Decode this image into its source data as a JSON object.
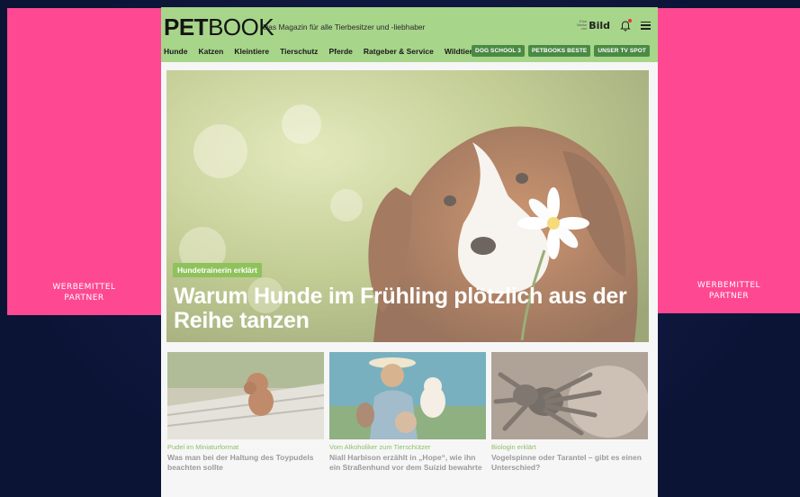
{
  "ads": {
    "left": {
      "line1": "WERBEMITTEL",
      "line2": "PARTNER"
    },
    "right": {
      "line1": "WERBEMITTEL",
      "line2": "PARTNER"
    }
  },
  "header": {
    "logo_bold": "PET",
    "logo_light": "BOOK",
    "tagline": "Das Magazin für alle Tierbesitzer und -liebhaber",
    "bild_small": "Eine Marke von",
    "bild_word": "Bild"
  },
  "nav": {
    "items": [
      "Hunde",
      "Katzen",
      "Kleintiere",
      "Tierschutz",
      "Pferde",
      "Ratgeber & Service",
      "Wildtiere"
    ],
    "buttons": [
      "DOG SCHOOL 3",
      "PETBOOKS BESTE",
      "UNSER TV SPOT"
    ]
  },
  "hero": {
    "tag": "Hundetrainerin erklärt",
    "headline": "Warum Hunde im Frühling plötzlich aus der Reihe tanzen"
  },
  "cards": [
    {
      "kicker": "Pudel im Miniaturformat",
      "title": "Was man bei der Haltung des Toypudels beachten sollte"
    },
    {
      "kicker": "Vom Alkoholiker zum Tierschützer",
      "title": "Niall Harbison erzählt in „Hope“, wie ihn ein Straßenhund vor dem Suizid bewahrte"
    },
    {
      "kicker": "Biologin erklärt",
      "title": "Vogelspinne oder Tarantel – gibt es einen Unterschied?"
    }
  ],
  "colors": {
    "ad_pink": "#ff4892",
    "header_green": "#a7d58a",
    "button_green": "#4a8a44",
    "background_navy": "#0c1436"
  }
}
